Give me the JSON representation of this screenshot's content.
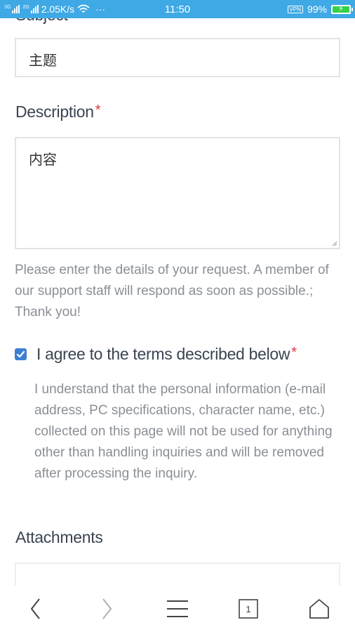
{
  "status_bar": {
    "sim1_tag": "2G",
    "sim2_tag": "2G",
    "net_speed": "2.05K/s",
    "more": "···",
    "time": "11:50",
    "vpn": "VPN",
    "battery": "99%",
    "battery_level": 0.99,
    "battery_color": "#36d14a",
    "bar_color": "#3fa9e6"
  },
  "form": {
    "subject_label_partial": "Subject",
    "subject_value": "主题",
    "description_label": "Description",
    "required_mark": "*",
    "description_value": "内容",
    "help_text": "Please enter the details of your request. A member of our support staff will respond as soon as possible.; Thank you!",
    "agree_label": "I agree to the terms described below",
    "agree_checked": true,
    "terms_text": "I understand that the personal information (e-mail address, PC specifications, character name, etc.) collected on this page will not be used for anything other than handling inquiries and will be removed after processing the inquiry.",
    "attachments_label": "Attachments"
  },
  "nav": {
    "back_icon": "chevron-left-icon",
    "forward_icon": "chevron-right-icon",
    "menu_icon": "menu-icon",
    "tabs_count": "1",
    "home_icon": "home-icon"
  }
}
